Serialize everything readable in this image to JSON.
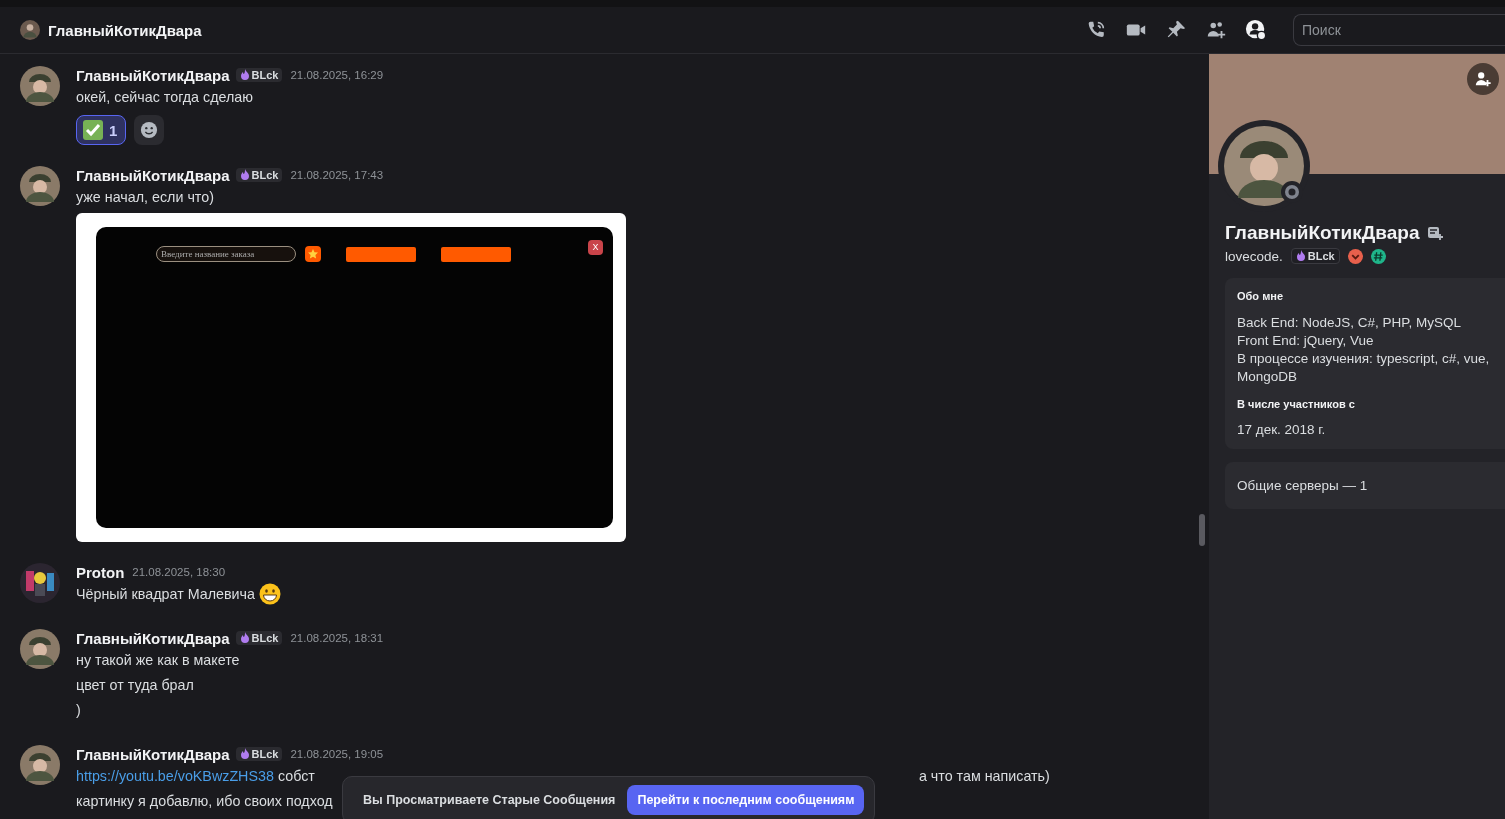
{
  "header": {
    "title": "ГлавныйКотикДвара",
    "search": {
      "placeholder": "Поиск"
    }
  },
  "messages": [
    {
      "author": "ГлавныйКотикДвара",
      "tag": "BLck",
      "time": "21.08.2025, 16:29",
      "kind": "user",
      "lines": [
        {
          "segments": [
            {
              "kind": "text",
              "text": "окей, сейчас тогда сделаю"
            }
          ]
        }
      ],
      "reactions": [
        {
          "count": "1",
          "selected": true
        }
      ]
    },
    {
      "author": "ГлавныйКотикДвара",
      "tag": "BLck",
      "time": "21.08.2025, 17:43",
      "kind": "user",
      "lines": [
        {
          "segments": [
            {
              "kind": "text",
              "text": "уже начал, если что)"
            }
          ]
        }
      ],
      "attachment": {
        "kind": "app_screenshot",
        "placeholder": "Введите название заказа",
        "close": "X"
      }
    },
    {
      "author": "Proton",
      "time": "21.08.2025, 18:30",
      "kind": "other",
      "lines": [
        {
          "segments": [
            {
              "kind": "text",
              "text": "Чёрный квадрат Малевича"
            },
            {
              "kind": "emoji"
            }
          ]
        }
      ]
    },
    {
      "author": "ГлавныйКотикДвара",
      "tag": "BLck",
      "time": "21.08.2025, 18:31",
      "kind": "user",
      "lines": [
        {
          "segments": [
            {
              "kind": "text",
              "text": "ну такой же как в макете"
            }
          ]
        },
        {
          "segments": [
            {
              "kind": "text",
              "text": "цвет от туда брал"
            }
          ]
        },
        {
          "segments": [
            {
              "kind": "text",
              "text": ")"
            }
          ]
        }
      ]
    },
    {
      "author": "ГлавныйКотикДвара",
      "tag": "BLck",
      "time": "21.08.2025, 19:05",
      "kind": "user",
      "lines": [
        {
          "segments": [
            {
              "kind": "link",
              "text": "https://youtu.be/voKBwzZHS38"
            },
            {
              "kind": "text",
              "text": "собст"
            },
            {
              "kind": "tail",
              "text": "а что там написать)"
            }
          ]
        },
        {
          "segments": [
            {
              "kind": "text",
              "text": "картинку я добавлю, ибо своих подход"
            }
          ]
        }
      ]
    }
  ],
  "toast": {
    "text": "Вы Просматриваете Старые Сообщения",
    "button": "Перейти к последним сообщениям"
  },
  "profile": {
    "name": "ГлавныйКотикДвара",
    "username": "lovecode.",
    "tag": "BLck",
    "online": false,
    "about_title": "Обо мне",
    "about_lines": [
      "Back End: NodeJS, C#, PHP, MySQL",
      "Front End: jQuery, Vue",
      "В процессе изучения: typescript, c#, vue, MongoDB"
    ],
    "member_since_title": "В числе участников с",
    "member_since": "17 дек. 2018 г.",
    "mutual_servers": "Общие серверы — 1"
  }
}
